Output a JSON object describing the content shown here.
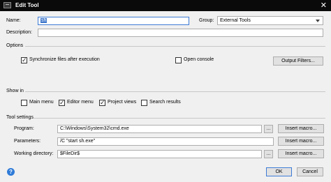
{
  "window": {
    "title": "Edit Tool",
    "close_symbol": "✕"
  },
  "fields": {
    "name_label": "Name:",
    "name_value": "sh",
    "group_label": "Group:",
    "group_value": "External Tools",
    "description_label": "Description:",
    "description_value": ""
  },
  "options": {
    "section_label": "Options",
    "sync_label": "Synchronize files after execution",
    "sync_checked": true,
    "open_console_label": "Open console",
    "open_console_checked": false,
    "output_filters_label": "Output Filters..."
  },
  "show_in": {
    "section_label": "Show in",
    "items": [
      {
        "label": "Main menu",
        "checked": false
      },
      {
        "label": "Editor menu",
        "checked": true
      },
      {
        "label": "Project views",
        "checked": true
      },
      {
        "label": "Search results",
        "checked": false
      }
    ]
  },
  "tool_settings": {
    "section_label": "Tool settings",
    "program_label": "Program:",
    "program_value": "C:\\Windows\\System32\\cmd.exe",
    "parameters_label": "Parameters:",
    "parameters_value": "/C \"start sh.exe\"",
    "working_dir_label": "Working directory:",
    "working_dir_value": "$FileDir$",
    "browse_label": "...",
    "insert_macro_label": "Insert macro..."
  },
  "footer": {
    "help_symbol": "?",
    "ok_label": "OK",
    "cancel_label": "Cancel"
  },
  "colors": {
    "titlebar": "#0a0a0a",
    "focus_border": "#3d7bd6",
    "selection": "#3b74c9",
    "help_icon": "#2f7bd8"
  }
}
